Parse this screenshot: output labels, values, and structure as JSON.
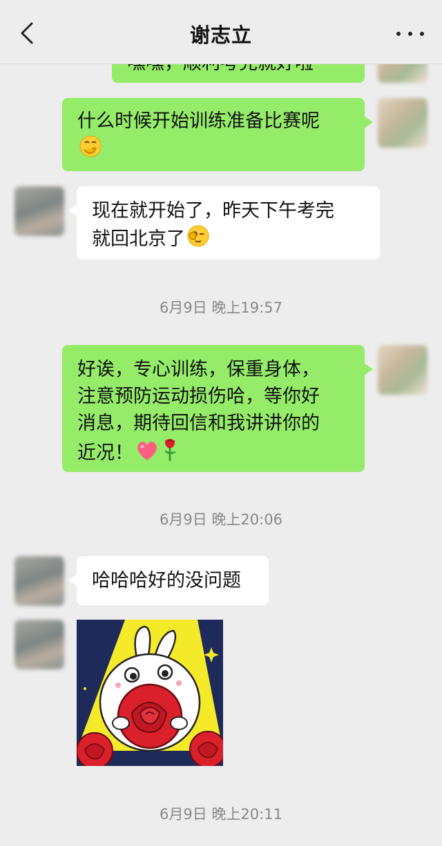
{
  "header": {
    "title": "谢志立"
  },
  "messages": {
    "m0": {
      "line1": "嘿嘿，顺利考完就好啦"
    },
    "m1": {
      "line1": "什么时候开始训练准备比赛呢"
    },
    "m2": {
      "line1": "现在就开始了，昨天下午考完",
      "line2": "就回北京了"
    },
    "t1": "6月9日 晚上19:57",
    "m3": {
      "line1": "好诶，专心训练，保重身体，",
      "line2": "注意预防运动损伤哈，等你好",
      "line3": "消息，期待回信和我讲讲你的",
      "line4": "近况！"
    },
    "t2": "6月9日 晚上20:06",
    "m4": {
      "line1": "哈哈哈好的没问题"
    },
    "t3": "6月9日 晚上20:11"
  },
  "colors": {
    "background": "#ededed",
    "my_bubble": "#95ec69",
    "other_bubble": "#ffffff",
    "timestamp": "#888888"
  },
  "icons": [
    "back-icon",
    "more-icon",
    "face-hand-over-mouth-emoji",
    "wink-emoji",
    "heart-emoji",
    "rose-emoji",
    "bunny-rose-sticker"
  ]
}
